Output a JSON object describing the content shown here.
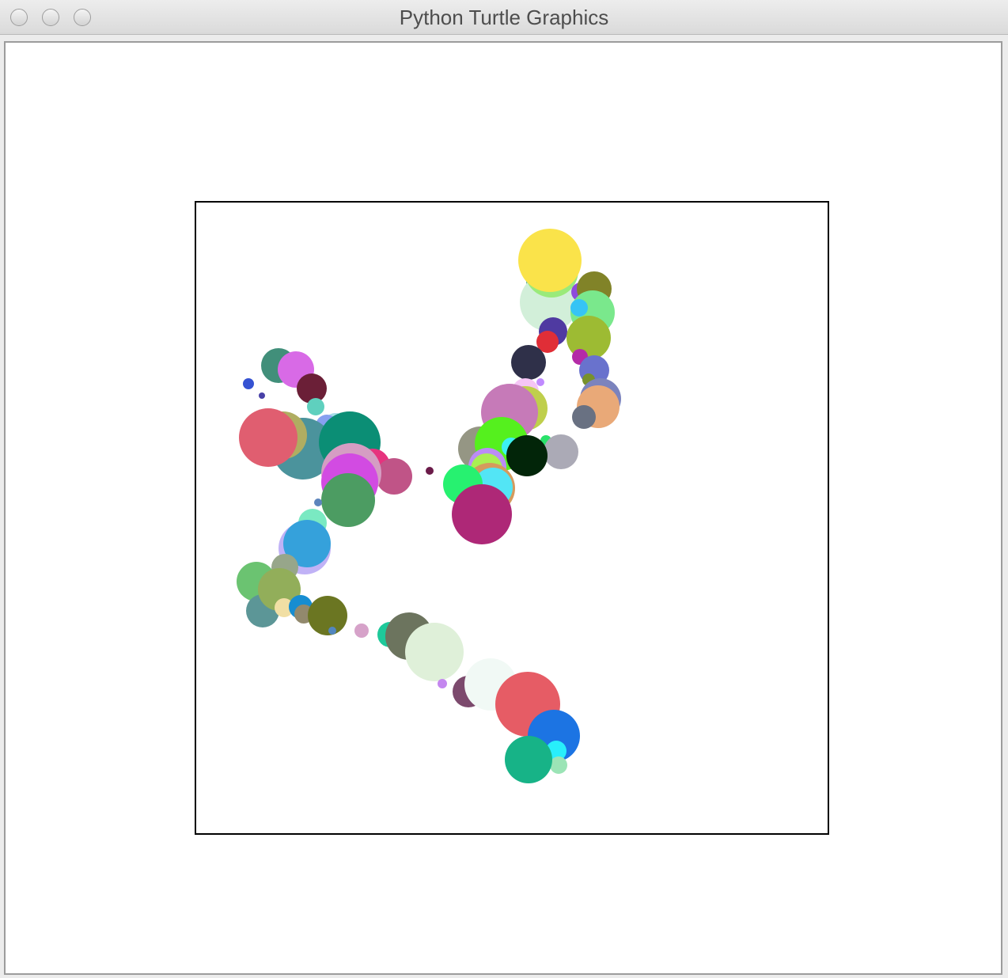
{
  "window": {
    "title": "Python Turtle Graphics"
  },
  "colors": {
    "frame_stroke": "#000000",
    "canvas_background": "#ffffff",
    "window_chrome": "#ececec"
  },
  "dots": [
    [
      "#5bb08f",
      693,
      353
    ],
    [
      "#d2efd9",
      692,
      380
    ],
    [
      "#9aea7a",
      695,
      340
    ],
    [
      "#fae34a",
      693,
      327
    ],
    [
      "#8e4bdc",
      732,
      367
    ],
    [
      "#818328",
      749,
      363
    ],
    [
      "#7ae88c",
      747,
      393
    ],
    [
      "#36c4f5",
      730,
      387
    ],
    [
      "#4f3aa1",
      697,
      417
    ],
    [
      "#e02e37",
      690,
      430
    ],
    [
      "#9dbb33",
      742,
      425
    ],
    [
      "#b42ba7",
      731,
      449
    ],
    [
      "#2f3049",
      666,
      456
    ],
    [
      "#6972cd",
      749,
      466
    ],
    [
      "#78912b",
      742,
      478
    ],
    [
      "#f5c5f5",
      662,
      493
    ],
    [
      "#c08aff",
      681,
      481
    ],
    [
      "#7b83bd",
      757,
      502
    ],
    [
      "#e9a978",
      754,
      512
    ],
    [
      "#697182",
      736,
      525
    ],
    [
      "#bfcf4c",
      662,
      514
    ],
    [
      "#c67ab8",
      642,
      519
    ],
    [
      "#959684",
      605,
      565
    ],
    [
      "#55f01e",
      632,
      559
    ],
    [
      "#29e26a",
      688,
      555
    ],
    [
      "#abaab6",
      707,
      569
    ],
    [
      "#3cf1f2",
      644,
      563
    ],
    [
      "#022509",
      664,
      574
    ],
    [
      "#bb8cf5",
      614,
      588
    ],
    [
      "#a9f052",
      613,
      591
    ],
    [
      "#d59a5d",
      617,
      615
    ],
    [
      "#53e5f5",
      621,
      614
    ],
    [
      "#27f170",
      583,
      610
    ],
    [
      "#ae2877",
      607,
      648
    ],
    [
      "#6b1b49",
      541,
      593
    ],
    [
      "#418f7a",
      350,
      460
    ],
    [
      "#d86ae6",
      372,
      465
    ],
    [
      "#3552d2",
      312,
      483
    ],
    [
      "#4840a7",
      329,
      498
    ],
    [
      "#6b1f37",
      392,
      489
    ],
    [
      "#5fd0be",
      397,
      512
    ],
    [
      "#a6dde8",
      422,
      536
    ],
    [
      "#87a0f0",
      411,
      536
    ],
    [
      "#4b939c",
      381,
      565
    ],
    [
      "#b0ad61",
      356,
      548
    ],
    [
      "#e05e70",
      337,
      551
    ],
    [
      "#0b8e75",
      440,
      557
    ],
    [
      "#e6337e",
      469,
      587
    ],
    [
      "#c05487",
      496,
      600
    ],
    [
      "#d59dc3",
      442,
      596
    ],
    [
      "#d24be2",
      440,
      607
    ],
    [
      "#4c9c62",
      438,
      630
    ],
    [
      "#5d85bd",
      400,
      633
    ],
    [
      "#7ae9c2",
      393,
      659
    ],
    [
      "#c0b2f6",
      383,
      691
    ],
    [
      "#35a1db",
      386,
      685
    ],
    [
      "#6bc371",
      322,
      733
    ],
    [
      "#97a68a",
      358,
      715
    ],
    [
      "#5c9697",
      330,
      770
    ],
    [
      "#92ae5a",
      351,
      743
    ],
    [
      "#f1dfa4",
      357,
      766
    ],
    [
      "#178dd1",
      378,
      765
    ],
    [
      "#92896d",
      382,
      774
    ],
    [
      "#6b7622",
      412,
      776
    ],
    [
      "#5286bf",
      418,
      795
    ],
    [
      "#d6a2c9",
      455,
      795
    ],
    [
      "#1ec99a",
      491,
      800
    ],
    [
      "#6c745e",
      515,
      802
    ],
    [
      "#dff0d9",
      547,
      822
    ],
    [
      "#c487ef",
      557,
      862
    ],
    [
      "#7c4a6d",
      590,
      872
    ],
    [
      "#f1f9f5",
      618,
      863
    ],
    [
      "#e65c65",
      665,
      888
    ],
    [
      "#1c74e3",
      698,
      928
    ],
    [
      "#28effb",
      701,
      947
    ],
    [
      "#9be4b6",
      704,
      965
    ],
    [
      "#17b387",
      666,
      958
    ]
  ]
}
